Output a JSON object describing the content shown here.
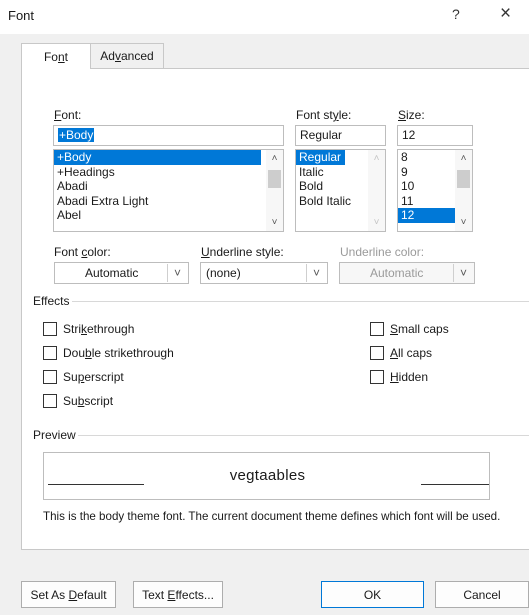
{
  "window": {
    "title": "Font",
    "help_label": "?",
    "close_label": "×"
  },
  "tabs": [
    {
      "pre": "Fo",
      "acc": "n",
      "post": "t",
      "active": true
    },
    {
      "pre": "Ad",
      "acc": "v",
      "post": "anced",
      "active": false
    }
  ],
  "font": {
    "label_acc": "F",
    "label_rest": "ont:",
    "value": "+Body",
    "items": [
      "+Body",
      "+Headings",
      "Abadi",
      "Abadi Extra Light",
      "Abel"
    ],
    "selected_index": 0
  },
  "style": {
    "label_pre": "Font st",
    "label_acc": "y",
    "label_post": "le:",
    "value": "Regular",
    "items": [
      "Regular",
      "Italic",
      "Bold",
      "Bold Italic"
    ],
    "selected_index": 0
  },
  "size": {
    "label_acc": "S",
    "label_rest": "ize:",
    "value": "12",
    "items": [
      "8",
      "9",
      "10",
      "11",
      "12"
    ],
    "selected_index": 4
  },
  "font_color": {
    "label_pre": "Font ",
    "label_acc": "c",
    "label_post": "olor:",
    "value": "Automatic"
  },
  "underline_style": {
    "label_acc": "U",
    "label_rest": "nderline style:",
    "value": "(none)"
  },
  "underline_color": {
    "label": "Underline color:",
    "value": "Automatic"
  },
  "effects": {
    "heading": "Effects",
    "left": [
      {
        "pre": "Stri",
        "acc": "k",
        "post": "ethrough",
        "checked": false
      },
      {
        "pre": "Dou",
        "acc": "b",
        "post": "le strikethrough",
        "checked": false
      },
      {
        "pre": "Su",
        "acc": "p",
        "post": "erscript",
        "checked": false
      },
      {
        "pre": "Su",
        "acc": "b",
        "post": "script",
        "checked": false
      }
    ],
    "right": [
      {
        "pre": "",
        "acc": "S",
        "post": "mall caps",
        "checked": false
      },
      {
        "pre": "",
        "acc": "A",
        "post": "ll caps",
        "checked": false
      },
      {
        "pre": "",
        "acc": "H",
        "post": "idden",
        "checked": false
      }
    ]
  },
  "preview": {
    "heading": "Preview",
    "sample_text": "vegtaables",
    "description": "This is the body theme font. The current document theme defines which font will be used."
  },
  "buttons": {
    "set_default": {
      "pre": "Set As ",
      "acc": "D",
      "post": "efault"
    },
    "text_effects": {
      "pre": "Text ",
      "acc": "E",
      "post": "ffects..."
    },
    "ok": "OK",
    "cancel": "Cancel"
  },
  "colors": {
    "selection": "#0078d7",
    "panel": "#ffffff",
    "chrome": "#f0f0f0"
  }
}
